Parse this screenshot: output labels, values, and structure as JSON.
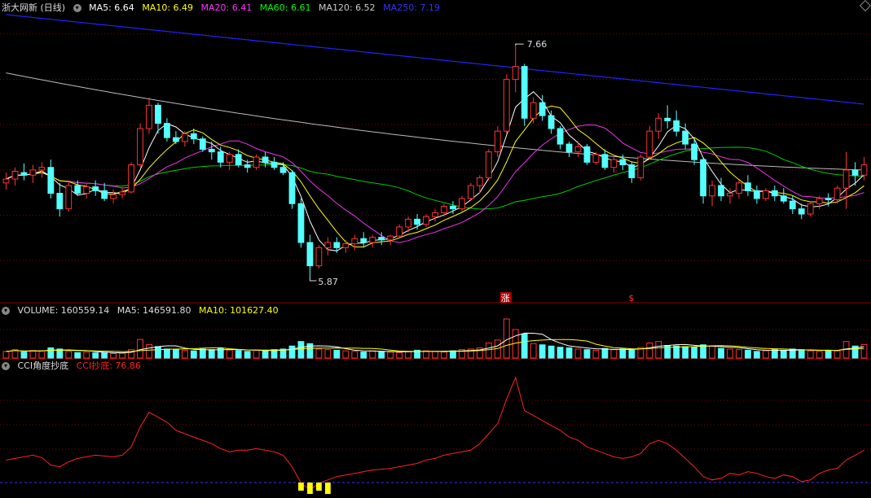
{
  "main": {
    "title": "浙大网新 (日线)",
    "indicators": [
      {
        "label": "MA5: 6.64",
        "color": "#ffffff"
      },
      {
        "label": "MA10: 6.49",
        "color": "#ffff00"
      },
      {
        "label": "MA20: 6.41",
        "color": "#ff33ff"
      },
      {
        "label": "MA60: 6.61",
        "color": "#00ff00"
      },
      {
        "label": "MA120: 6.52",
        "color": "#cccccc"
      },
      {
        "label": "MA250: 7.19",
        "color": "#3333ff"
      }
    ],
    "high_label": "7.66",
    "low_label": "5.87",
    "marker_zhang": "涨",
    "marker_s": "$"
  },
  "volume": {
    "indicators": [
      {
        "label": "VOLUME: 160559.14",
        "color": "#dddddd"
      },
      {
        "label": "MA5: 146591.80",
        "color": "#dddddd"
      },
      {
        "label": "MA10: 101627.40",
        "color": "#ffff00"
      }
    ]
  },
  "cci": {
    "indicators": [
      {
        "label": "CCI角度抄底",
        "color": "#dddddd"
      },
      {
        "label": "CCI抄底: 76.86",
        "color": "#ff2222"
      }
    ]
  },
  "colors": {
    "up": "#ff3333",
    "down": "#54ffff",
    "grid": "#880000",
    "ma250": "#2222ff",
    "ma120": "#bbbbbb",
    "ma60": "#00cc00",
    "ma20": "#ee33ee",
    "ma10": "#ffff00",
    "ma5": "#ffffff",
    "cci": "#ff2222",
    "bottom": "#ffff00"
  },
  "chart_data": {
    "type": "candlestick",
    "price_range": [
      5.7,
      7.9
    ],
    "candles_ohlc": [
      [
        6.6,
        6.68,
        6.55,
        6.63
      ],
      [
        6.63,
        6.72,
        6.58,
        6.69
      ],
      [
        6.68,
        6.75,
        6.62,
        6.66
      ],
      [
        6.66,
        6.74,
        6.6,
        6.7
      ],
      [
        6.7,
        6.76,
        6.64,
        6.72
      ],
      [
        6.72,
        6.78,
        6.48,
        6.52
      ],
      [
        6.52,
        6.6,
        6.34,
        6.4
      ],
      [
        6.4,
        6.62,
        6.38,
        6.58
      ],
      [
        6.58,
        6.62,
        6.5,
        6.52
      ],
      [
        6.52,
        6.6,
        6.48,
        6.57
      ],
      [
        6.57,
        6.62,
        6.5,
        6.54
      ],
      [
        6.54,
        6.6,
        6.46,
        6.48
      ],
      [
        6.48,
        6.55,
        6.44,
        6.51
      ],
      [
        6.51,
        6.56,
        6.48,
        6.53
      ],
      [
        6.53,
        6.76,
        6.52,
        6.74
      ],
      [
        6.74,
        7.06,
        6.72,
        7.02
      ],
      [
        7.02,
        7.26,
        6.98,
        7.2
      ],
      [
        7.2,
        7.22,
        6.98,
        7.06
      ],
      [
        7.06,
        7.1,
        6.92,
        6.95
      ],
      [
        6.95,
        7.0,
        6.9,
        6.92
      ],
      [
        6.92,
        7.0,
        6.88,
        6.98
      ],
      [
        6.98,
        7.02,
        6.9,
        6.94
      ],
      [
        6.94,
        6.96,
        6.84,
        6.86
      ],
      [
        6.86,
        6.92,
        6.78,
        6.84
      ],
      [
        6.84,
        6.88,
        6.72,
        6.76
      ],
      [
        6.76,
        6.84,
        6.7,
        6.82
      ],
      [
        6.82,
        6.86,
        6.72,
        6.74
      ],
      [
        6.74,
        6.78,
        6.68,
        6.72
      ],
      [
        6.72,
        6.82,
        6.7,
        6.8
      ],
      [
        6.8,
        6.84,
        6.72,
        6.76
      ],
      [
        6.76,
        6.8,
        6.7,
        6.72
      ],
      [
        6.72,
        6.76,
        6.66,
        6.68
      ],
      [
        6.68,
        6.7,
        6.4,
        6.44
      ],
      [
        6.44,
        6.48,
        6.1,
        6.14
      ],
      [
        6.14,
        6.2,
        5.87,
        5.96
      ],
      [
        5.96,
        6.12,
        5.94,
        6.1
      ],
      [
        6.1,
        6.18,
        6.04,
        6.14
      ],
      [
        6.14,
        6.18,
        6.06,
        6.1
      ],
      [
        6.1,
        6.16,
        6.06,
        6.13
      ],
      [
        6.13,
        6.2,
        6.08,
        6.17
      ],
      [
        6.17,
        6.22,
        6.1,
        6.14
      ],
      [
        6.14,
        6.2,
        6.1,
        6.18
      ],
      [
        6.18,
        6.22,
        6.12,
        6.16
      ],
      [
        6.16,
        6.2,
        6.12,
        6.19
      ],
      [
        6.19,
        6.28,
        6.18,
        6.26
      ],
      [
        6.26,
        6.34,
        6.22,
        6.32
      ],
      [
        6.32,
        6.36,
        6.24,
        6.28
      ],
      [
        6.28,
        6.36,
        6.26,
        6.34
      ],
      [
        6.34,
        6.4,
        6.3,
        6.37
      ],
      [
        6.37,
        6.44,
        6.34,
        6.42
      ],
      [
        6.42,
        6.46,
        6.36,
        6.4
      ],
      [
        6.4,
        6.5,
        6.38,
        6.48
      ],
      [
        6.48,
        6.6,
        6.46,
        6.58
      ],
      [
        6.58,
        6.66,
        6.52,
        6.64
      ],
      [
        6.64,
        6.86,
        6.62,
        6.84
      ],
      [
        6.84,
        7.04,
        6.8,
        7.0
      ],
      [
        7.0,
        7.44,
        6.98,
        7.4
      ],
      [
        7.4,
        7.66,
        7.3,
        7.5
      ],
      [
        7.5,
        7.52,
        7.04,
        7.1
      ],
      [
        7.1,
        7.26,
        7.06,
        7.22
      ],
      [
        7.22,
        7.28,
        7.08,
        7.12
      ],
      [
        7.12,
        7.16,
        6.98,
        7.02
      ],
      [
        7.02,
        7.04,
        6.86,
        6.9
      ],
      [
        6.9,
        6.92,
        6.8,
        6.84
      ],
      [
        6.84,
        6.92,
        6.8,
        6.88
      ],
      [
        6.88,
        6.9,
        6.74,
        6.76
      ],
      [
        6.76,
        6.84,
        6.74,
        6.82
      ],
      [
        6.82,
        6.86,
        6.7,
        6.72
      ],
      [
        6.72,
        6.8,
        6.68,
        6.78
      ],
      [
        6.78,
        6.82,
        6.7,
        6.74
      ],
      [
        6.74,
        6.76,
        6.6,
        6.64
      ],
      [
        6.64,
        6.82,
        6.62,
        6.8
      ],
      [
        6.8,
        7.04,
        6.78,
        7.0
      ],
      [
        7.0,
        7.14,
        6.94,
        7.1
      ],
      [
        7.1,
        7.2,
        7.02,
        7.08
      ],
      [
        7.08,
        7.16,
        6.96,
        7.0
      ],
      [
        7.0,
        7.06,
        6.86,
        6.9
      ],
      [
        6.9,
        6.94,
        6.74,
        6.78
      ],
      [
        6.78,
        6.8,
        6.44,
        6.5
      ],
      [
        6.5,
        6.62,
        6.42,
        6.58
      ],
      [
        6.58,
        6.64,
        6.46,
        6.5
      ],
      [
        6.5,
        6.56,
        6.44,
        6.52
      ],
      [
        6.52,
        6.62,
        6.48,
        6.6
      ],
      [
        6.6,
        6.66,
        6.5,
        6.54
      ],
      [
        6.54,
        6.58,
        6.44,
        6.48
      ],
      [
        6.48,
        6.56,
        6.46,
        6.54
      ],
      [
        6.54,
        6.58,
        6.46,
        6.5
      ],
      [
        6.5,
        6.56,
        6.44,
        6.46
      ],
      [
        6.46,
        6.5,
        6.36,
        6.4
      ],
      [
        6.4,
        6.44,
        6.32,
        6.36
      ],
      [
        6.36,
        6.46,
        6.34,
        6.44
      ],
      [
        6.44,
        6.5,
        6.4,
        6.48
      ],
      [
        6.48,
        6.52,
        6.42,
        6.47
      ],
      [
        6.47,
        6.58,
        6.44,
        6.56
      ],
      [
        6.56,
        6.84,
        6.4,
        6.7
      ],
      [
        6.7,
        6.76,
        6.58,
        6.66
      ],
      [
        6.66,
        6.8,
        6.62,
        6.74
      ]
    ],
    "volume": [
      22,
      28,
      20,
      25,
      24,
      34,
      30,
      22,
      18,
      20,
      17,
      19,
      15,
      16,
      28,
      62,
      45,
      38,
      30,
      28,
      26,
      24,
      30,
      28,
      32,
      27,
      25,
      22,
      26,
      24,
      28,
      30,
      40,
      55,
      48,
      30,
      28,
      26,
      24,
      22,
      20,
      24,
      22,
      20,
      18,
      22,
      26,
      24,
      22,
      20,
      24,
      28,
      30,
      34,
      50,
      60,
      130,
      95,
      80,
      48,
      44,
      40,
      36,
      34,
      30,
      28,
      26,
      32,
      28,
      30,
      26,
      35,
      50,
      55,
      42,
      40,
      38,
      36,
      44,
      40,
      32,
      30,
      28,
      26,
      22,
      24,
      28,
      26,
      30,
      28,
      24,
      22,
      26,
      24,
      55,
      40,
      45
    ],
    "cci": [
      -120,
      -110,
      -100,
      -90,
      -105,
      -150,
      -160,
      -130,
      -110,
      -100,
      -90,
      -95,
      -100,
      -90,
      -40,
      80,
      170,
      140,
      110,
      60,
      40,
      20,
      0,
      -20,
      -50,
      -70,
      -60,
      -60,
      -50,
      -60,
      -70,
      -90,
      -160,
      -260,
      -300,
      -260,
      -240,
      -220,
      -210,
      -200,
      -190,
      -180,
      -175,
      -170,
      -160,
      -150,
      -140,
      -120,
      -110,
      -90,
      -80,
      -70,
      -60,
      -20,
      40,
      100,
      250,
      380,
      180,
      150,
      120,
      90,
      60,
      20,
      0,
      -40,
      -60,
      -80,
      -100,
      -110,
      -100,
      -80,
      -20,
      0,
      -20,
      -60,
      -110,
      -160,
      -220,
      -240,
      -230,
      -200,
      -210,
      -190,
      -200,
      -220,
      -230,
      -210,
      -220,
      -250,
      -240,
      -200,
      -180,
      -170,
      -120,
      -90,
      -60
    ],
    "cci_bottom_signal_indices": [
      33,
      34,
      35,
      36
    ]
  }
}
